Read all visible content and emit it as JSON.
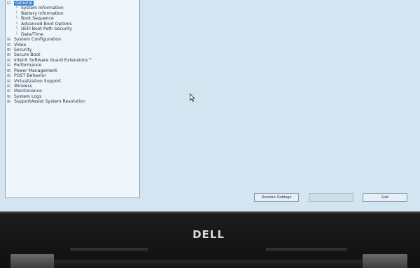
{
  "settings_tree": [
    {
      "level": 0,
      "expander": "⊟",
      "label": "General",
      "selected": true
    },
    {
      "level": 1,
      "expander": "",
      "label": "System Information"
    },
    {
      "level": 1,
      "expander": "",
      "label": "Battery Information"
    },
    {
      "level": 1,
      "expander": "",
      "label": "Boot Sequence"
    },
    {
      "level": 1,
      "expander": "",
      "label": "Advanced Boot Options"
    },
    {
      "level": 1,
      "expander": "",
      "label": "UEFI Boot Path Security"
    },
    {
      "level": 1,
      "expander": "",
      "label": "Date/Time"
    },
    {
      "level": 0,
      "expander": "⊞",
      "label": "System Configuration"
    },
    {
      "level": 0,
      "expander": "⊞",
      "label": "Video"
    },
    {
      "level": 0,
      "expander": "⊞",
      "label": "Security"
    },
    {
      "level": 0,
      "expander": "⊞",
      "label": "Secure Boot"
    },
    {
      "level": 0,
      "expander": "⊞",
      "label": "Intel® Software Guard Extensions™"
    },
    {
      "level": 0,
      "expander": "⊞",
      "label": "Performance"
    },
    {
      "level": 0,
      "expander": "⊞",
      "label": "Power Management"
    },
    {
      "level": 0,
      "expander": "⊞",
      "label": "POST Behavior"
    },
    {
      "level": 0,
      "expander": "⊞",
      "label": "Virtualization Support"
    },
    {
      "level": 0,
      "expander": "⊞",
      "label": "Wireless"
    },
    {
      "level": 0,
      "expander": "⊞",
      "label": "Maintenance"
    },
    {
      "level": 0,
      "expander": "⊞",
      "label": "System Logs"
    },
    {
      "level": 0,
      "expander": "⊞",
      "label": "SupportAssist System Resolution"
    }
  ],
  "buttons": {
    "restore_label": "Restore Settings",
    "apply_label": "",
    "exit_label": "Exit"
  },
  "bezel": {
    "logo_text": "DELL"
  },
  "icons": {
    "cursor": "mouse-pointer-icon"
  },
  "colors": {
    "screen_background": "#d3e5f0",
    "tree_background": "#eef5fb",
    "selection": "#3a7fd1",
    "bezel": "#1c1c1c"
  }
}
